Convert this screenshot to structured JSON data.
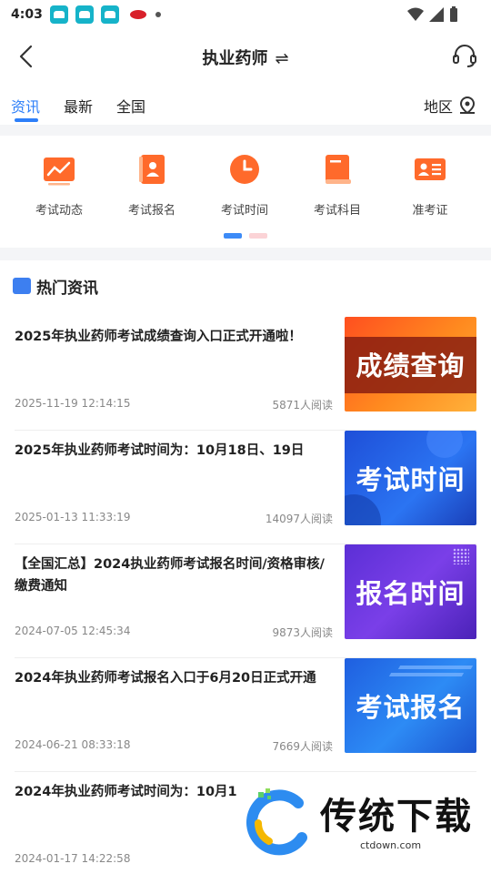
{
  "status": {
    "time": "4:03"
  },
  "header": {
    "title": "执业药师",
    "switch_glyph": "⇌"
  },
  "tabs": [
    {
      "label": "资讯",
      "active": true
    },
    {
      "label": "最新",
      "active": false
    },
    {
      "label": "全国",
      "active": false
    }
  ],
  "region": {
    "label": "地区"
  },
  "quick_nav": [
    {
      "label": "考试动态",
      "icon": "trend-chart-icon"
    },
    {
      "label": "考试报名",
      "icon": "register-book-icon"
    },
    {
      "label": "考试时间",
      "icon": "clock-icon"
    },
    {
      "label": "考试科目",
      "icon": "subject-book-icon"
    },
    {
      "label": "准考证",
      "icon": "id-card-icon"
    }
  ],
  "section": {
    "title": "热门资讯"
  },
  "news": [
    {
      "title": "2025年执业药师考试成绩查询入口正式开通啦！",
      "date": "2025-11-19 12:14:15",
      "views": "5871人阅读",
      "thumb_text": "成绩查询"
    },
    {
      "title": "2025年执业药师考试时间为：10月18日、19日",
      "date": "2025-01-13 11:33:19",
      "views": "14097人阅读",
      "thumb_text": "考试时间"
    },
    {
      "title": "【全国汇总】2024执业药师考试报名时间/资格审核/缴费通知",
      "date": "2024-07-05 12:45:34",
      "views": "9873人阅读",
      "thumb_text": "报名时间"
    },
    {
      "title": "2024年执业药师考试报名入口于6月20日正式开通",
      "date": "2024-06-21 08:33:18",
      "views": "7669人阅读",
      "thumb_text": "考试报名"
    },
    {
      "title": "2024年执业药师考试时间为：10月1",
      "date": "2024-01-17 14:22:58",
      "views": "",
      "thumb_text": ""
    }
  ],
  "watermark": {
    "text": "传统下载",
    "url": "ctdown.com"
  },
  "colors": {
    "accent": "#2d7ff9",
    "icon_orange": "#ff6a2b"
  }
}
